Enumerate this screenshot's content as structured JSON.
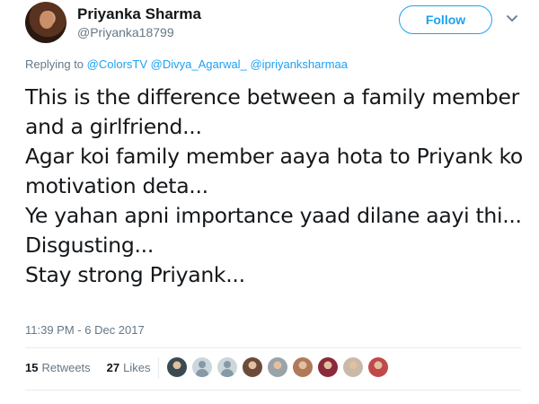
{
  "author": {
    "name": "Priyanka Sharma",
    "handle": "@Priyanka18799"
  },
  "follow_button": {
    "label": "Follow"
  },
  "reply": {
    "prefix": "Replying to",
    "mentions": [
      "@ColorsTV",
      "@Divya_Agarwal_",
      "@ipriyanksharmaa"
    ]
  },
  "tweet": {
    "text": "This is the difference between a family member and a girlfriend...\nAgar koi family member aaya hota to Priyank ko motivation deta...\nYe yahan apni importance yaad  dilane aayi thi...\nDisgusting...\nStay strong Priyank...",
    "timestamp": "11:39 PM - 6 Dec 2017"
  },
  "stats": {
    "retweets_count": "15",
    "retweets_label": "Retweets",
    "likes_count": "27",
    "likes_label": "Likes"
  },
  "colors": {
    "accent": "#1da1f2",
    "text": "#14171a",
    "secondary": "#657786",
    "divider": "#e6ecf0"
  },
  "likers": [
    {
      "kind": "photo",
      "color": "#3b4a52"
    },
    {
      "kind": "default",
      "color": "#ccd6dd"
    },
    {
      "kind": "default",
      "color": "#ccd6dd"
    },
    {
      "kind": "photo",
      "color": "#6b4a3a"
    },
    {
      "kind": "photo",
      "color": "#9aa3a8"
    },
    {
      "kind": "photo",
      "color": "#b07a5a"
    },
    {
      "kind": "photo",
      "color": "#8a2a3a"
    },
    {
      "kind": "photo",
      "color": "#c9b9a8"
    },
    {
      "kind": "photo",
      "color": "#c04a4a"
    }
  ]
}
